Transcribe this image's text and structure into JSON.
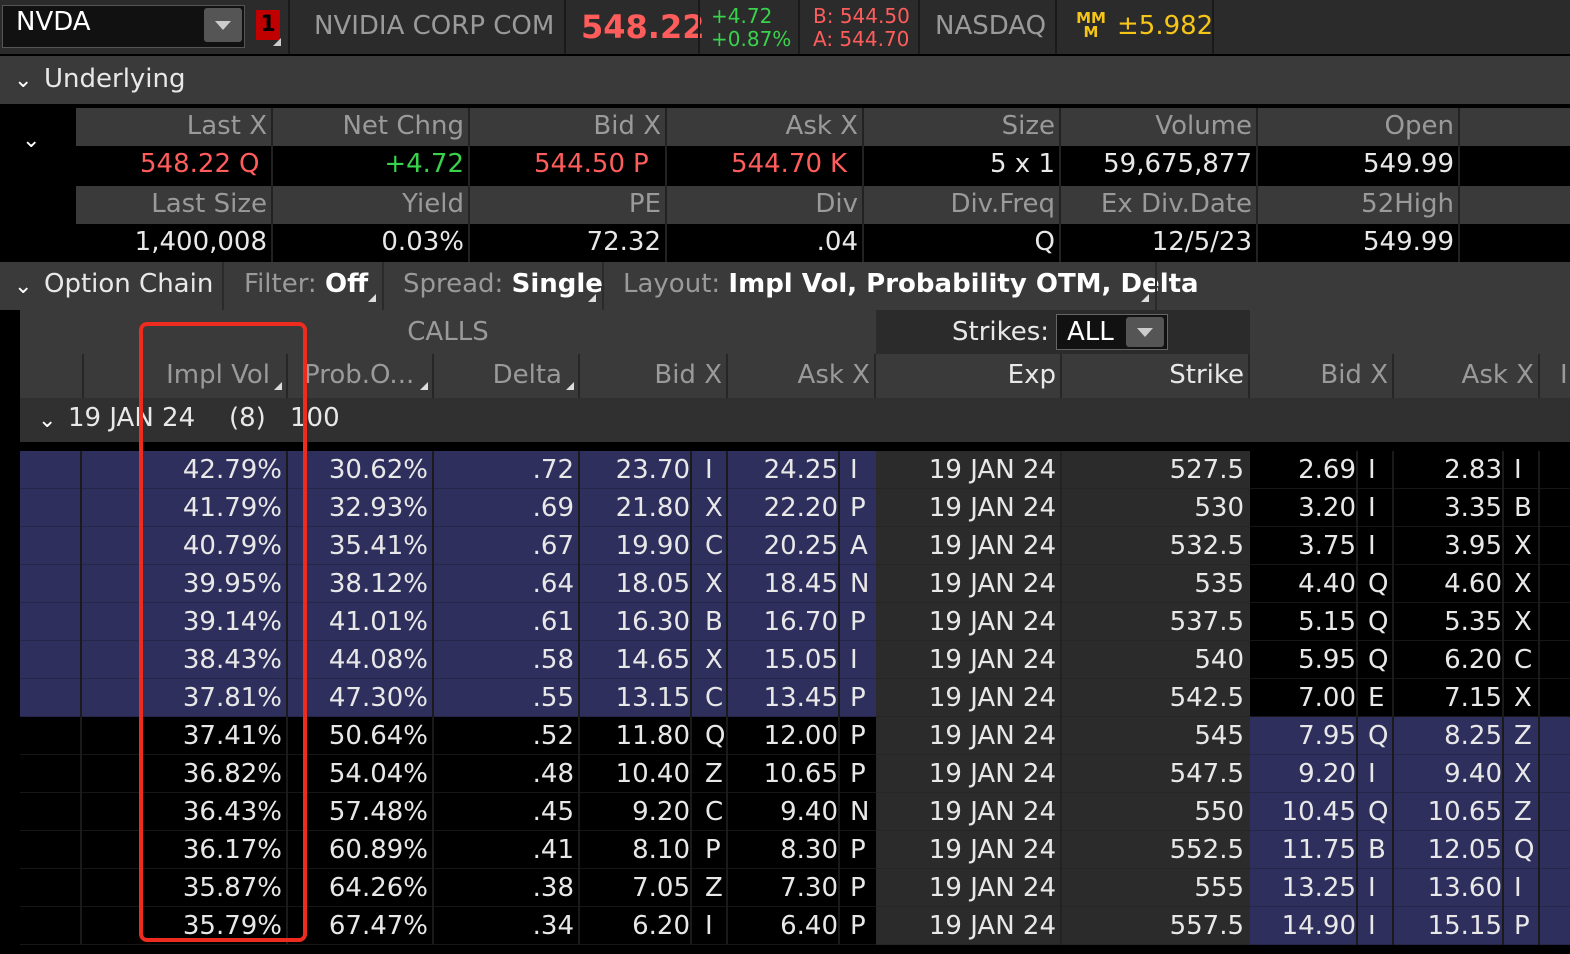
{
  "top": {
    "symbol": "NVDA",
    "badge": "1",
    "company": "NVIDIA CORP COM",
    "last": "548.22",
    "chg": "+4.72",
    "chg_pct": "+0.87%",
    "bid": "B: 544.50",
    "ask": "A: 544.70",
    "exchange": "NASDAQ",
    "mm_logo": "MM M",
    "mm_value": "±5.982"
  },
  "underlying": {
    "title": "Underlying",
    "headers1": [
      "Last X",
      "Net Chng",
      "Bid X",
      "Ask X",
      "Size",
      "Volume",
      "Open"
    ],
    "values1": [
      "548.22",
      "+4.72",
      "544.50",
      "544.70",
      "5 x 1",
      "59,675,877",
      "549.99"
    ],
    "exch1": [
      "Q",
      "",
      "P",
      "K",
      "",
      "",
      ""
    ],
    "headers2": [
      "Last Size",
      "Yield",
      "PE",
      "Div",
      "Div.Freq",
      "Ex Div.Date",
      "52High"
    ],
    "values2": [
      "1,400,008",
      "0.03%",
      "72.32",
      ".04",
      "Q",
      "12/5/23",
      "549.99"
    ]
  },
  "chain_bar": {
    "title": "Option Chain",
    "filter_label": "Filter:",
    "filter_value": "Off",
    "spread_label": "Spread:",
    "spread_value": "Single",
    "layout_label": "Layout:",
    "layout_value": "Impl Vol, Probability OTM, Delta"
  },
  "chain": {
    "calls_label": "CALLS",
    "strikes_label": "Strikes:",
    "strikes_value": "ALL",
    "headers": {
      "impl_vol": "Impl Vol",
      "prob": "Prob.O...",
      "delta": "Delta",
      "bid": "Bid X",
      "ask": "Ask X",
      "exp": "Exp",
      "strike": "Strike",
      "put_bid": "Bid X",
      "put_ask": "Ask X",
      "put_more": "I"
    },
    "group": {
      "label": "19 JAN 24",
      "count": "(8)",
      "mult": "100"
    },
    "rows": [
      {
        "iv": "42.79%",
        "prob": "30.62%",
        "delta": ".72",
        "bid": "23.70",
        "bx": "I",
        "ask": "24.25",
        "ax": "I",
        "exp": "19 JAN 24",
        "strike": "527.5",
        "pbid": "2.69",
        "pbx": "I",
        "pask": "2.83",
        "pax": "I",
        "call_itm": true,
        "put_itm": false
      },
      {
        "iv": "41.79%",
        "prob": "32.93%",
        "delta": ".69",
        "bid": "21.80",
        "bx": "X",
        "ask": "22.20",
        "ax": "P",
        "exp": "19 JAN 24",
        "strike": "530",
        "pbid": "3.20",
        "pbx": "I",
        "pask": "3.35",
        "pax": "B",
        "call_itm": true,
        "put_itm": false
      },
      {
        "iv": "40.79%",
        "prob": "35.41%",
        "delta": ".67",
        "bid": "19.90",
        "bx": "C",
        "ask": "20.25",
        "ax": "A",
        "exp": "19 JAN 24",
        "strike": "532.5",
        "pbid": "3.75",
        "pbx": "I",
        "pask": "3.95",
        "pax": "X",
        "call_itm": true,
        "put_itm": false
      },
      {
        "iv": "39.95%",
        "prob": "38.12%",
        "delta": ".64",
        "bid": "18.05",
        "bx": "X",
        "ask": "18.45",
        "ax": "N",
        "exp": "19 JAN 24",
        "strike": "535",
        "pbid": "4.40",
        "pbx": "Q",
        "pask": "4.60",
        "pax": "X",
        "call_itm": true,
        "put_itm": false
      },
      {
        "iv": "39.14%",
        "prob": "41.01%",
        "delta": ".61",
        "bid": "16.30",
        "bx": "B",
        "ask": "16.70",
        "ax": "P",
        "exp": "19 JAN 24",
        "strike": "537.5",
        "pbid": "5.15",
        "pbx": "Q",
        "pask": "5.35",
        "pax": "X",
        "call_itm": true,
        "put_itm": false
      },
      {
        "iv": "38.43%",
        "prob": "44.08%",
        "delta": ".58",
        "bid": "14.65",
        "bx": "X",
        "ask": "15.05",
        "ax": "I",
        "exp": "19 JAN 24",
        "strike": "540",
        "pbid": "5.95",
        "pbx": "Q",
        "pask": "6.20",
        "pax": "C",
        "call_itm": true,
        "put_itm": false
      },
      {
        "iv": "37.81%",
        "prob": "47.30%",
        "delta": ".55",
        "bid": "13.15",
        "bx": "C",
        "ask": "13.45",
        "ax": "P",
        "exp": "19 JAN 24",
        "strike": "542.5",
        "pbid": "7.00",
        "pbx": "E",
        "pask": "7.15",
        "pax": "X",
        "call_itm": true,
        "put_itm": false
      },
      {
        "iv": "37.41%",
        "prob": "50.64%",
        "delta": ".52",
        "bid": "11.80",
        "bx": "Q",
        "ask": "12.00",
        "ax": "P",
        "exp": "19 JAN 24",
        "strike": "545",
        "pbid": "7.95",
        "pbx": "Q",
        "pask": "8.25",
        "pax": "Z",
        "call_itm": false,
        "put_itm": true
      },
      {
        "iv": "36.82%",
        "prob": "54.04%",
        "delta": ".48",
        "bid": "10.40",
        "bx": "Z",
        "ask": "10.65",
        "ax": "P",
        "exp": "19 JAN 24",
        "strike": "547.5",
        "pbid": "9.20",
        "pbx": "I",
        "pask": "9.40",
        "pax": "X",
        "call_itm": false,
        "put_itm": true
      },
      {
        "iv": "36.43%",
        "prob": "57.48%",
        "delta": ".45",
        "bid": "9.20",
        "bx": "C",
        "ask": "9.40",
        "ax": "N",
        "exp": "19 JAN 24",
        "strike": "550",
        "pbid": "10.45",
        "pbx": "Q",
        "pask": "10.65",
        "pax": "Z",
        "call_itm": false,
        "put_itm": true
      },
      {
        "iv": "36.17%",
        "prob": "60.89%",
        "delta": ".41",
        "bid": "8.10",
        "bx": "P",
        "ask": "8.30",
        "ax": "P",
        "exp": "19 JAN 24",
        "strike": "552.5",
        "pbid": "11.75",
        "pbx": "B",
        "pask": "12.05",
        "pax": "Q",
        "call_itm": false,
        "put_itm": true
      },
      {
        "iv": "35.87%",
        "prob": "64.26%",
        "delta": ".38",
        "bid": "7.05",
        "bx": "Z",
        "ask": "7.30",
        "ax": "P",
        "exp": "19 JAN 24",
        "strike": "555",
        "pbid": "13.25",
        "pbx": "I",
        "pask": "13.60",
        "pax": "I",
        "call_itm": false,
        "put_itm": true
      },
      {
        "iv": "35.79%",
        "prob": "67.47%",
        "delta": ".34",
        "bid": "6.20",
        "bx": "I",
        "ask": "6.40",
        "ax": "P",
        "exp": "19 JAN 24",
        "strike": "557.5",
        "pbid": "14.90",
        "pbx": "I",
        "pask": "15.15",
        "pax": "P",
        "call_itm": false,
        "put_itm": true
      }
    ]
  },
  "colors": {
    "itm_row": "#2e2f5c",
    "highlight": "#ee2b1f",
    "up": "#39d24c",
    "down": "#ff5c5c"
  }
}
